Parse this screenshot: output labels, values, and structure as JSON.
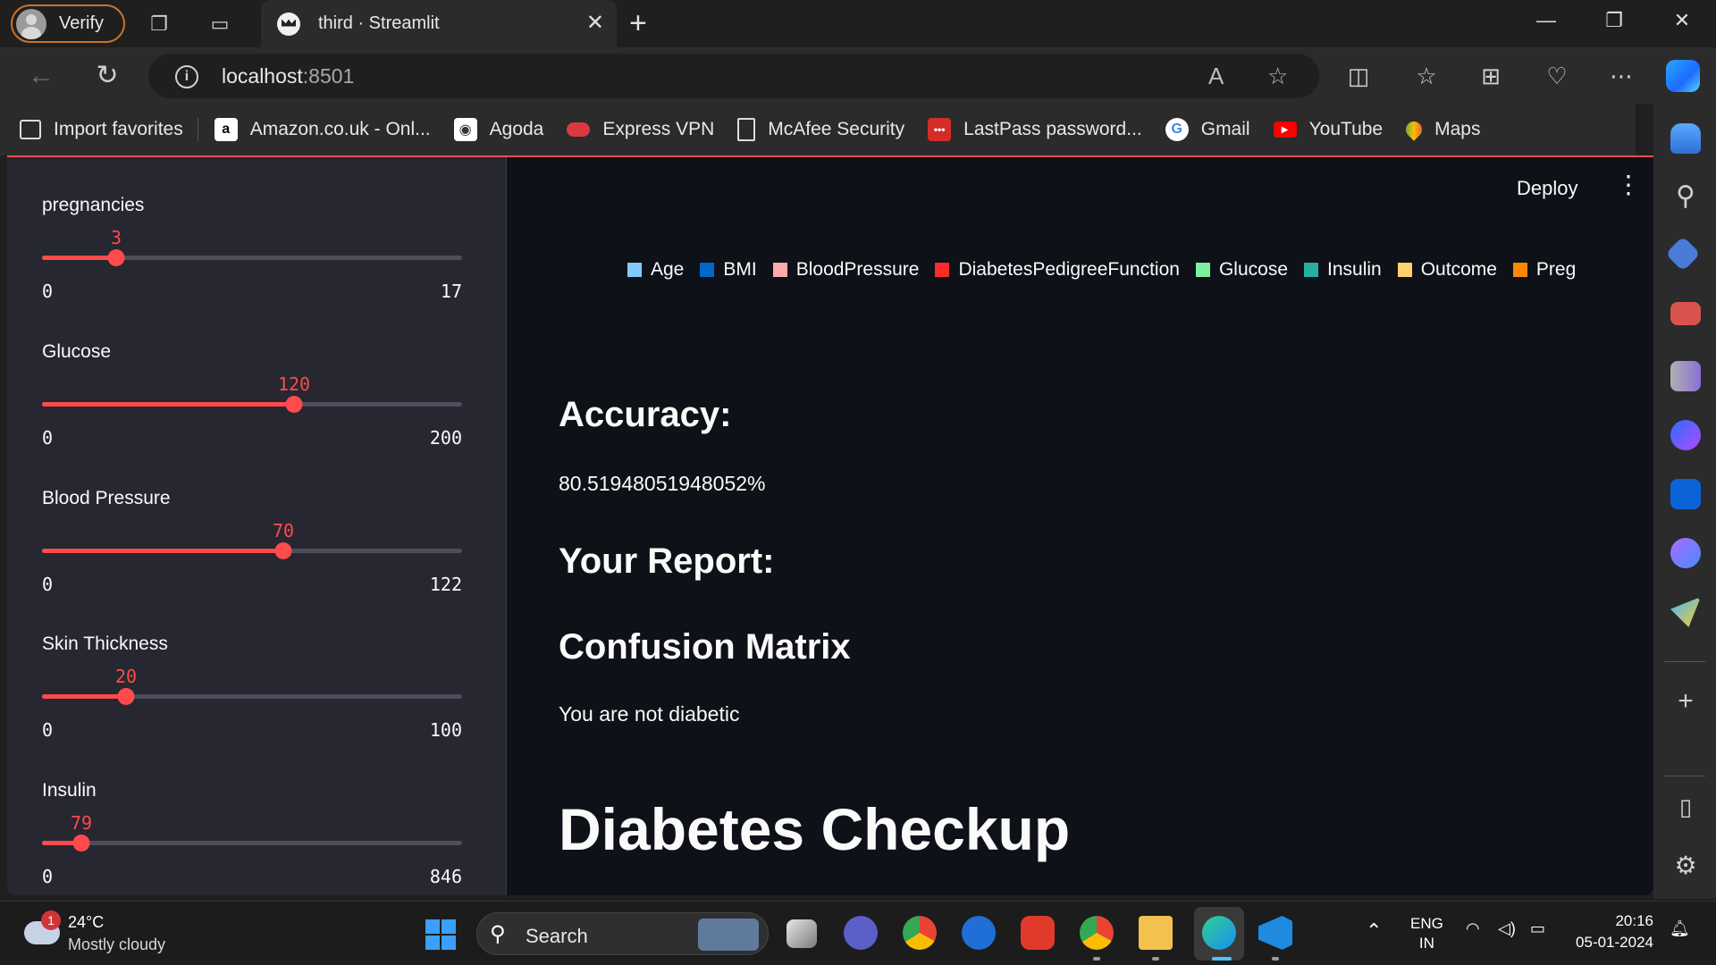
{
  "browser": {
    "profile_label": "Verify",
    "tab_title": "third · Streamlit",
    "url_host": "localhost",
    "url_port": ":8501",
    "favorites": [
      {
        "label": "Import favorites",
        "icon": "import-icon"
      },
      {
        "label": "Amazon.co.uk - Onl...",
        "icon": "amazon-icon"
      },
      {
        "label": "Agoda",
        "icon": "agoda-icon"
      },
      {
        "label": "Express VPN",
        "icon": "expressvpn-icon"
      },
      {
        "label": "McAfee Security",
        "icon": "page-icon"
      },
      {
        "label": "LastPass password...",
        "icon": "lastpass-icon"
      },
      {
        "label": "Gmail",
        "icon": "google-icon"
      },
      {
        "label": "YouTube",
        "icon": "youtube-icon"
      },
      {
        "label": "Maps",
        "icon": "maps-icon"
      }
    ]
  },
  "sidebar": {
    "sliders": [
      {
        "label": "pregnancies",
        "value": "3",
        "min": "0",
        "max": "17",
        "fraction": 0.176
      },
      {
        "label": "Glucose",
        "value": "120",
        "min": "0",
        "max": "200",
        "fraction": 0.6
      },
      {
        "label": "Blood Pressure",
        "value": "70",
        "min": "0",
        "max": "122",
        "fraction": 0.574
      },
      {
        "label": "Skin Thickness",
        "value": "20",
        "min": "0",
        "max": "100",
        "fraction": 0.2
      },
      {
        "label": "Insulin",
        "value": "79",
        "min": "0",
        "max": "846",
        "fraction": 0.093
      }
    ]
  },
  "main": {
    "deploy_label": "Deploy",
    "legend": [
      {
        "label": "Age",
        "color": "#83c9ff"
      },
      {
        "label": "BMI",
        "color": "#0068c9"
      },
      {
        "label": "BloodPressure",
        "color": "#ffabab"
      },
      {
        "label": "DiabetesPedigreeFunction",
        "color": "#ff2b2b"
      },
      {
        "label": "Glucose",
        "color": "#7defa1"
      },
      {
        "label": "Insulin",
        "color": "#29b09d"
      },
      {
        "label": "Outcome",
        "color": "#ffd16a"
      },
      {
        "label": "Preg",
        "color": "#ff8700"
      }
    ],
    "accuracy_heading": "Accuracy:",
    "accuracy_value": "80.51948051948052%",
    "report_heading": "Your Report:",
    "confusion_heading": "Confusion Matrix",
    "result_text": "You are not diabetic",
    "title": "Diabetes Checkup"
  },
  "taskbar": {
    "weather_badge": "1",
    "weather_temp": "24°C",
    "weather_desc": "Mostly cloudy",
    "search_label": "Search",
    "lang_line1": "ENG",
    "lang_line2": "IN",
    "time": "20:16",
    "date": "05-01-2024"
  },
  "colors": {
    "accent": "#ff4b4b",
    "app_bg": "#0e1117",
    "sidebar_bg": "#262730"
  }
}
